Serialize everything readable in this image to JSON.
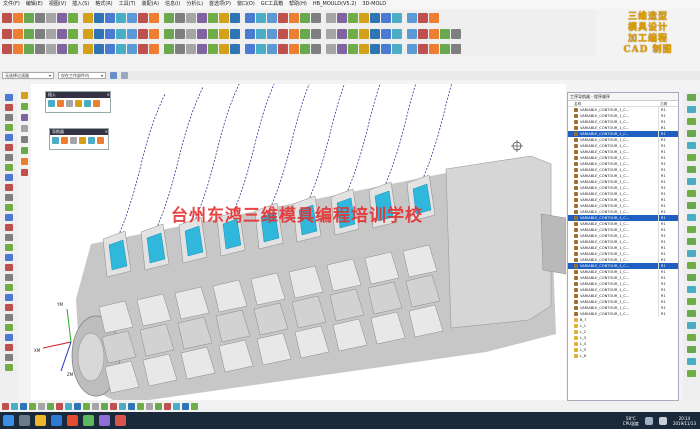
{
  "menu": [
    "文件(F)",
    "编辑(E)",
    "视图(V)",
    "插入(S)",
    "格式(R)",
    "工具(T)",
    "装配(A)",
    "信息(I)",
    "分析(L)",
    "首选项(P)",
    "窗口(O)",
    "GC工具箱",
    "帮助(H)",
    "HB_MOULD(V5.2)",
    "3D-MOLD"
  ],
  "promo": {
    "line1": "三维造型",
    "line2": "模具设计",
    "line3": "加工编程",
    "line4": "CAD 制图"
  },
  "selection": {
    "filter": "无选择过滤器",
    "scope": "仅在工作部件内"
  },
  "panels": {
    "insert_title": "插入",
    "navigator_title": "导航器"
  },
  "watermark": "台州东鸿三维模具编程培训学校",
  "wcs": {
    "ym": "YM",
    "xm": "XM",
    "zm": "ZM"
  },
  "ops_nav": {
    "title": "工序导航器 - 程序顺序",
    "col_name": "名称",
    "col_tool": "刀具",
    "rows": [
      {
        "name": "VARIABLE_CONTOUR_1_C...",
        "tool": "R1",
        "hl": false
      },
      {
        "name": "VARIABLE_CONTOUR_1_C...",
        "tool": "R1",
        "hl": false
      },
      {
        "name": "VARIABLE_CONTOUR_1_C...",
        "tool": "R1",
        "hl": false
      },
      {
        "name": "VARIABLE_CONTOUR_1_C...",
        "tool": "R1",
        "hl": false
      },
      {
        "name": "VARIABLE_CONTOUR_1_C...",
        "tool": "R1",
        "hl": true
      },
      {
        "name": "VARIABLE_CONTOUR_1_C...",
        "tool": "R1",
        "hl": false
      },
      {
        "name": "VARIABLE_CONTOUR_1_C...",
        "tool": "R1",
        "hl": false
      },
      {
        "name": "VARIABLE_CONTOUR_1_C...",
        "tool": "R1",
        "hl": false
      },
      {
        "name": "VARIABLE_CONTOUR_1_C...",
        "tool": "R1",
        "hl": false
      },
      {
        "name": "VARIABLE_CONTOUR_1_C...",
        "tool": "R1",
        "hl": false
      },
      {
        "name": "VARIABLE_CONTOUR_1_C...",
        "tool": "R1",
        "hl": false
      },
      {
        "name": "VARIABLE_CONTOUR_1_C...",
        "tool": "R1",
        "hl": false
      },
      {
        "name": "VARIABLE_CONTOUR_1_C...",
        "tool": "R1",
        "hl": false
      },
      {
        "name": "VARIABLE_CONTOUR_1_C...",
        "tool": "R1",
        "hl": false
      },
      {
        "name": "VARIABLE_CONTOUR_1_C...",
        "tool": "R1",
        "hl": false
      },
      {
        "name": "VARIABLE_CONTOUR_1_C...",
        "tool": "R1",
        "hl": false
      },
      {
        "name": "VARIABLE_CONTOUR_1_C...",
        "tool": "R1",
        "hl": false
      },
      {
        "name": "VARIABLE_CONTOUR_1_C...",
        "tool": "R1",
        "hl": false
      },
      {
        "name": "VARIABLE_CONTOUR_1_C...",
        "tool": "R1",
        "hl": true
      },
      {
        "name": "VARIABLE_CONTOUR_1_C...",
        "tool": "R1",
        "hl": false
      },
      {
        "name": "VARIABLE_CONTOUR_1_C...",
        "tool": "R1",
        "hl": false
      },
      {
        "name": "VARIABLE_CONTOUR_1_C...",
        "tool": "R1",
        "hl": false
      },
      {
        "name": "VARIABLE_CONTOUR_1_C...",
        "tool": "R1",
        "hl": false
      },
      {
        "name": "VARIABLE_CONTOUR_1_C...",
        "tool": "R1",
        "hl": false
      },
      {
        "name": "VARIABLE_CONTOUR_1_C...",
        "tool": "R1",
        "hl": false
      },
      {
        "name": "VARIABLE_CONTOUR_1_C...",
        "tool": "R1",
        "hl": false
      },
      {
        "name": "VARIABLE_CONTOUR_1_C...",
        "tool": "R1",
        "hl": true
      },
      {
        "name": "VARIABLE_CONTOUR_1_C...",
        "tool": "R1",
        "hl": false
      },
      {
        "name": "VARIABLE_CONTOUR_1_C...",
        "tool": "R1",
        "hl": false
      },
      {
        "name": "VARIABLE_CONTOUR_1_C...",
        "tool": "R1",
        "hl": false
      },
      {
        "name": "VARIABLE_CONTOUR_1_C...",
        "tool": "R1",
        "hl": false
      },
      {
        "name": "VARIABLE_CONTOUR_1_C...",
        "tool": "R1",
        "hl": false
      },
      {
        "name": "VARIABLE_CONTOUR_1_C...",
        "tool": "R1",
        "hl": false
      },
      {
        "name": "VARIABLE_CONTOUR_1_C...",
        "tool": "R1",
        "hl": false
      },
      {
        "name": "VARIABLE_CONTOUR_1_C...",
        "tool": "R1",
        "hl": false
      }
    ],
    "folders": [
      "B_7",
      "L_1",
      "L_2",
      "L_3",
      "L_4",
      "L_5",
      "L_6"
    ]
  },
  "taskbar": {
    "temp": "58°C",
    "temp_label": "CPU温度",
    "time": "20:14",
    "date": "2019/11/13"
  }
}
